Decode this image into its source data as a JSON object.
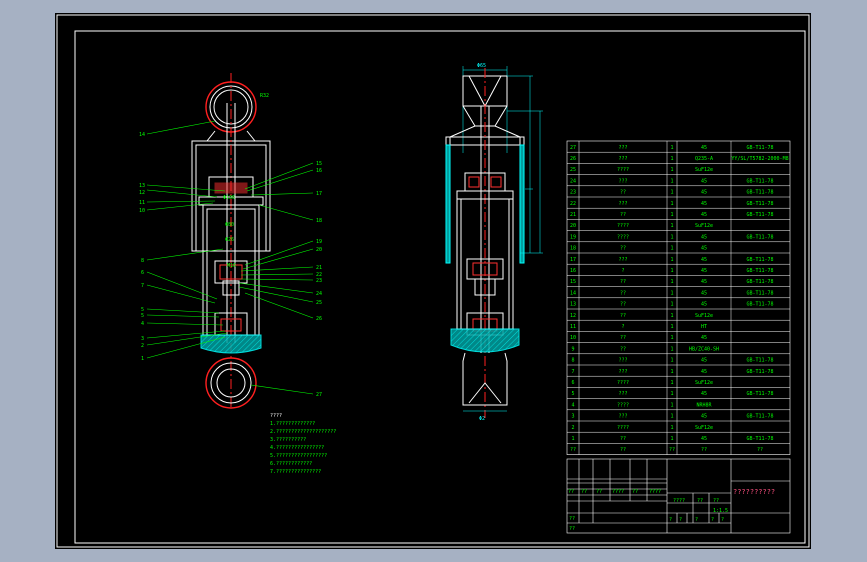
{
  "drawing": {
    "left_view": {
      "callouts_left": [
        "14",
        "13",
        "12",
        "11",
        "10",
        "8",
        "6",
        "7",
        "5",
        "5",
        "4",
        "3",
        "2",
        "1"
      ],
      "callouts_right": [
        "15",
        "16",
        "17",
        "18",
        "19",
        "20",
        "21",
        "22",
        "23",
        "24",
        "25",
        "26",
        "27"
      ],
      "dims": [
        "R32",
        "Φ136",
        "Φ80",
        "Φ26",
        "M16"
      ]
    },
    "right_view": {
      "dims": [
        "Φ65",
        "Φ2"
      ]
    },
    "notes": {
      "title": "????",
      "lines": [
        "1.?????????????",
        "2.????????????????????",
        "3.??????????",
        "4.????????????????",
        "5.?????????????????",
        "6.????????????",
        "7.???????????????"
      ]
    }
  },
  "parts_table": {
    "rows": [
      {
        "no": "27",
        "name": "???",
        "qty": "1",
        "mat": "45",
        "std": "GB-T11-78"
      },
      {
        "no": "26",
        "name": "???",
        "qty": "1",
        "mat": "Q235-A",
        "std": "YY/SL/T5782-2000-M8"
      },
      {
        "no": "25",
        "name": "????",
        "qty": "1",
        "mat": "SuF12e",
        "std": ""
      },
      {
        "no": "24",
        "name": "???",
        "qty": "1",
        "mat": "45",
        "std": "GB-T11-78"
      },
      {
        "no": "23",
        "name": "??",
        "qty": "1",
        "mat": "45",
        "std": "GB-T11-78"
      },
      {
        "no": "22",
        "name": "???",
        "qty": "1",
        "mat": "45",
        "std": "GB-T11-78"
      },
      {
        "no": "21",
        "name": "??",
        "qty": "1",
        "mat": "45",
        "std": "GB-T11-78"
      },
      {
        "no": "20",
        "name": "????",
        "qty": "1",
        "mat": "SuF12e",
        "std": ""
      },
      {
        "no": "19",
        "name": "????",
        "qty": "1",
        "mat": "45",
        "std": "GB-T11-78"
      },
      {
        "no": "18",
        "name": "??",
        "qty": "1",
        "mat": "45",
        "std": ""
      },
      {
        "no": "17",
        "name": "???",
        "qty": "1",
        "mat": "45",
        "std": "GB-T11-78"
      },
      {
        "no": "16",
        "name": "?",
        "qty": "1",
        "mat": "45",
        "std": "GB-T11-78"
      },
      {
        "no": "15",
        "name": "??",
        "qty": "1",
        "mat": "45",
        "std": "GB-T11-78"
      },
      {
        "no": "14",
        "name": "??",
        "qty": "1",
        "mat": "45",
        "std": "GB-T11-78"
      },
      {
        "no": "13",
        "name": "??",
        "qty": "1",
        "mat": "45",
        "std": "GB-T11-78"
      },
      {
        "no": "12",
        "name": "??",
        "qty": "1",
        "mat": "SuF12e",
        "std": ""
      },
      {
        "no": "11",
        "name": "?",
        "qty": "1",
        "mat": "HT",
        "std": ""
      },
      {
        "no": "10",
        "name": "??",
        "qty": "1",
        "mat": "45",
        "std": ""
      },
      {
        "no": "9",
        "name": "??",
        "qty": "1",
        "mat": "HB/ZC40-SH",
        "std": ""
      },
      {
        "no": "8",
        "name": "???",
        "qty": "1",
        "mat": "45",
        "std": "GB-T11-78"
      },
      {
        "no": "7",
        "name": "???",
        "qty": "1",
        "mat": "45",
        "std": "GB-T11-78"
      },
      {
        "no": "6",
        "name": "????",
        "qty": "1",
        "mat": "SuF12e",
        "std": ""
      },
      {
        "no": "5",
        "name": "???",
        "qty": "1",
        "mat": "45",
        "std": "GB-T11-78"
      },
      {
        "no": "4",
        "name": "????",
        "qty": "1",
        "mat": "NRH8R",
        "std": ""
      },
      {
        "no": "3",
        "name": "???",
        "qty": "1",
        "mat": "45",
        "std": "GB-T11-78"
      },
      {
        "no": "2",
        "name": "????",
        "qty": "1",
        "mat": "SuF12e",
        "std": ""
      },
      {
        "no": "1",
        "name": "??",
        "qty": "1",
        "mat": "45",
        "std": "GB-T11-78"
      }
    ],
    "header": {
      "no": "??",
      "name": "??",
      "qty": "??",
      "mat": "??",
      "std": "??"
    }
  },
  "title_block": {
    "drawing_title": "??????????",
    "sign_row": [
      "??",
      "??",
      "??",
      "????",
      "??",
      "????"
    ],
    "labels_row": [
      "??",
      "??"
    ],
    "scale_row": [
      "????",
      "??",
      "??"
    ],
    "scale_val": "1:1.5",
    "sheet_row": [
      "?",
      "?",
      "?",
      "?",
      "?"
    ]
  }
}
